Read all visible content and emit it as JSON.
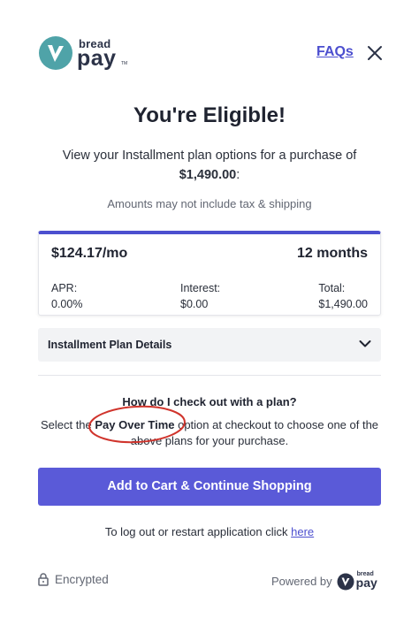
{
  "header": {
    "brand_top": "bread",
    "brand_bottom": "pay",
    "brand_tm": "TM",
    "faqs_label": "FAQs",
    "logo_color": "#4fa3a8",
    "accent_color": "#4c4fcf"
  },
  "main": {
    "title": "You're Eligible!",
    "subtitle_prefix": "View your Installment plan options for a purchase of",
    "purchase_amount": "$1,490.00",
    "subtitle_suffix": ":",
    "note": "Amounts may not include tax & shipping"
  },
  "plan": {
    "monthly": "$124.17/mo",
    "term": "12 months",
    "apr_label": "APR:",
    "apr_value": "0.00%",
    "interest_label": "Interest:",
    "interest_value": "$0.00",
    "total_label": "Total:",
    "total_value": "$1,490.00"
  },
  "details": {
    "label": "Installment Plan Details",
    "icon": "chevron-down-icon"
  },
  "howto": {
    "title": "How do I check out with a plan?",
    "text_before": "Select the ",
    "highlight": "Pay Over Time",
    "text_after": " option at checkout to choose one of the above plans for your purchase.",
    "annotation_color": "#d0342c"
  },
  "cta": {
    "label": "Add to Cart & Continue Shopping",
    "color": "#5a5ad8"
  },
  "logout": {
    "text": "To log out or restart application click ",
    "link": "here"
  },
  "footer": {
    "encrypted": "Encrypted",
    "powered_by": "Powered by",
    "mini_brand_top": "bread",
    "mini_brand_bottom": "pay"
  }
}
